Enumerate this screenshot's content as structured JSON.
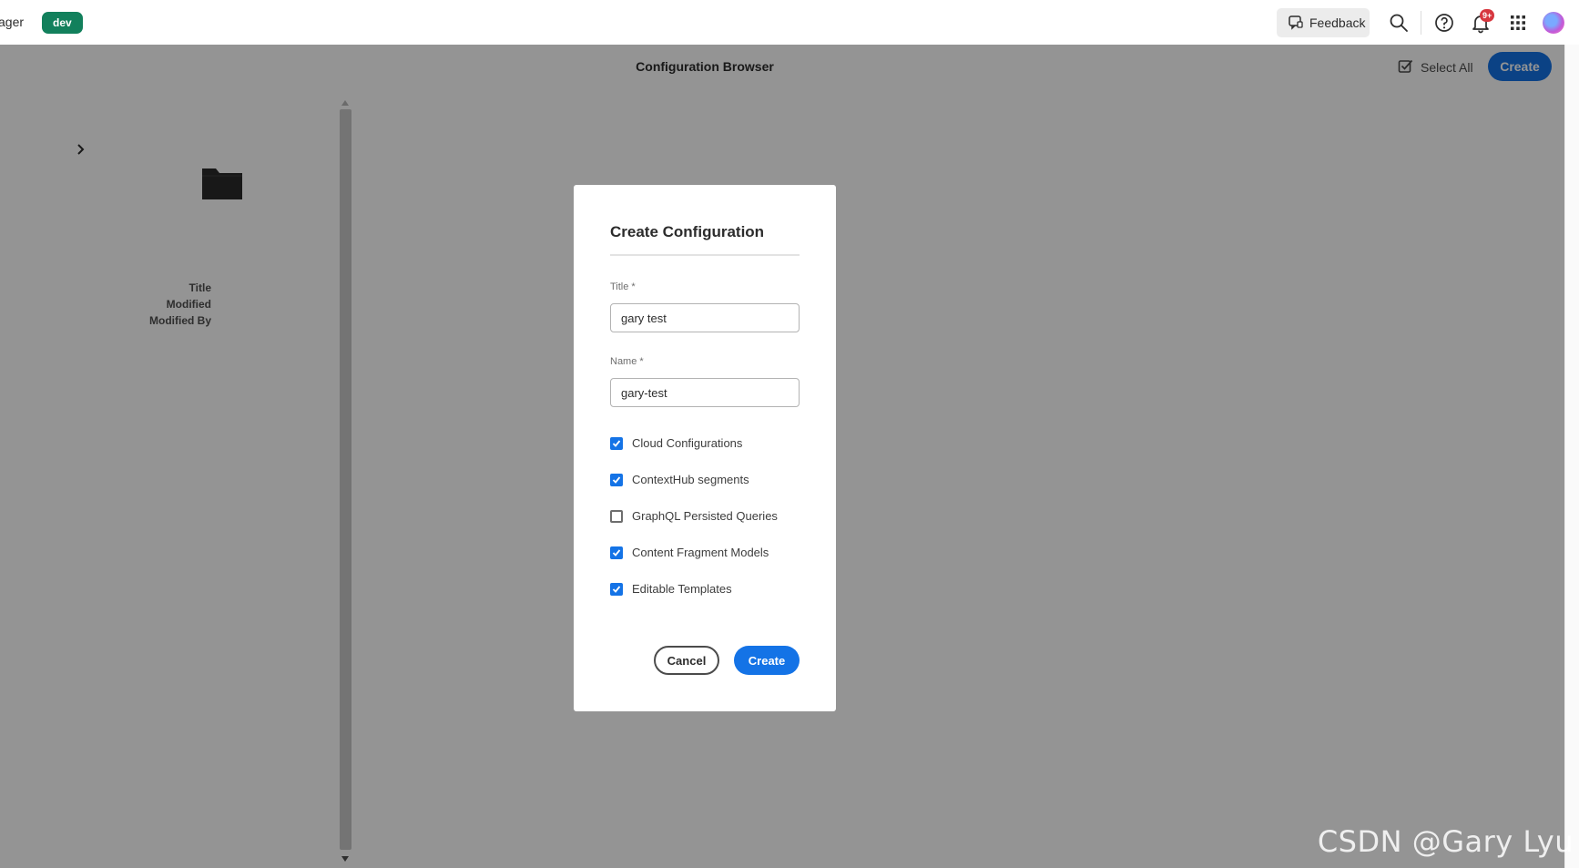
{
  "header": {
    "product_name": "ager",
    "env_badge": "dev",
    "feedback_label": "Feedback",
    "notification_count": "9+",
    "icons": [
      "feedback-icon",
      "search-icon",
      "help-icon",
      "bell-icon",
      "apps-grid-icon"
    ]
  },
  "action_bar": {
    "title": "Configuration Browser",
    "select_all_label": "Select All",
    "create_label": "Create"
  },
  "column": {
    "meta_labels": [
      "Title",
      "Modified",
      "Modified By"
    ]
  },
  "dialog": {
    "title": "Create Configuration",
    "title_field": {
      "label": "Title *",
      "value": "gary test"
    },
    "name_field": {
      "label": "Name *",
      "value": "gary-test"
    },
    "options": [
      {
        "label": "Cloud Configurations",
        "checked": true
      },
      {
        "label": "ContextHub segments",
        "checked": true
      },
      {
        "label": "GraphQL Persisted Queries",
        "checked": false
      },
      {
        "label": "Content Fragment Models",
        "checked": true
      },
      {
        "label": "Editable Templates",
        "checked": true
      }
    ],
    "cancel_label": "Cancel",
    "create_label": "Create"
  },
  "colors": {
    "accent": "#1473e6",
    "badge": "#12805c",
    "notification": "#d7373f"
  },
  "watermark": "CSDN @Gary Lyu"
}
